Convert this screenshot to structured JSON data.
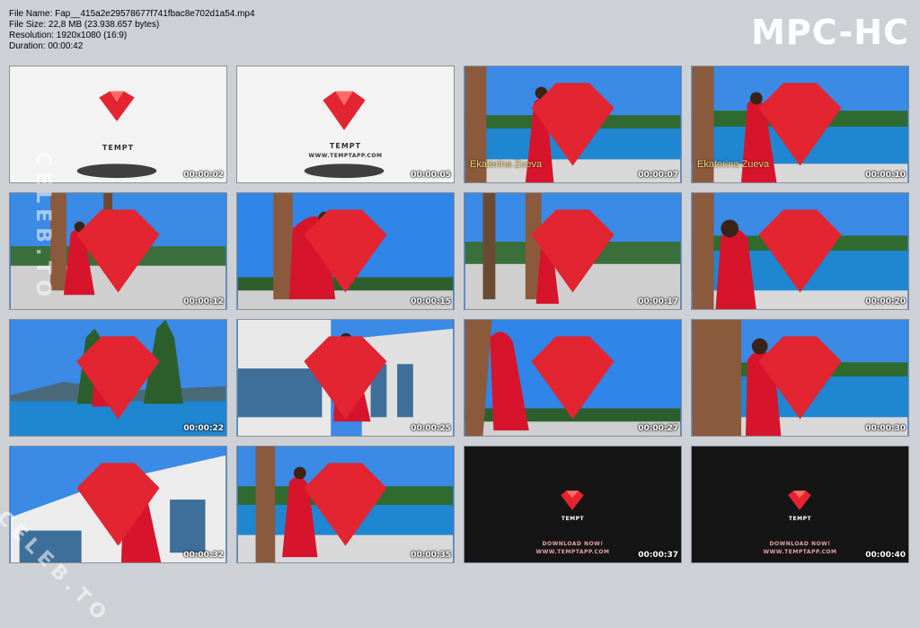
{
  "file_info": {
    "name_line": "File Name: Fap__415a2e29578677f741fbac8e702d1a54.mp4",
    "size_line": "File Size: 22,8 MB (23.938.657 bytes)",
    "resolution_line": "Resolution: 1920x1080 (16:9)",
    "duration_line": "Duration: 00:00:42"
  },
  "brand": "MPC-HC",
  "watermark": "CELEB.TO",
  "logo": {
    "name": "TEMPT",
    "url": "WWW.TEMPTAPP.COM",
    "download": "DOWNLOAD NOW!"
  },
  "caption": "Ekaterina Zueva",
  "timestamps": [
    "00:00:02",
    "00:00:05",
    "00:00:07",
    "00:00:10",
    "00:00:12",
    "00:00:15",
    "00:00:17",
    "00:00:20",
    "00:00:22",
    "00:00:25",
    "00:00:27",
    "00:00:30",
    "00:00:32",
    "00:00:35",
    "00:00:37",
    "00:00:40"
  ],
  "colors": {
    "dress": "#d6152c",
    "sky": "#2e7fe0",
    "pool": "#2a8ed8",
    "logo_red": "#e32431"
  }
}
